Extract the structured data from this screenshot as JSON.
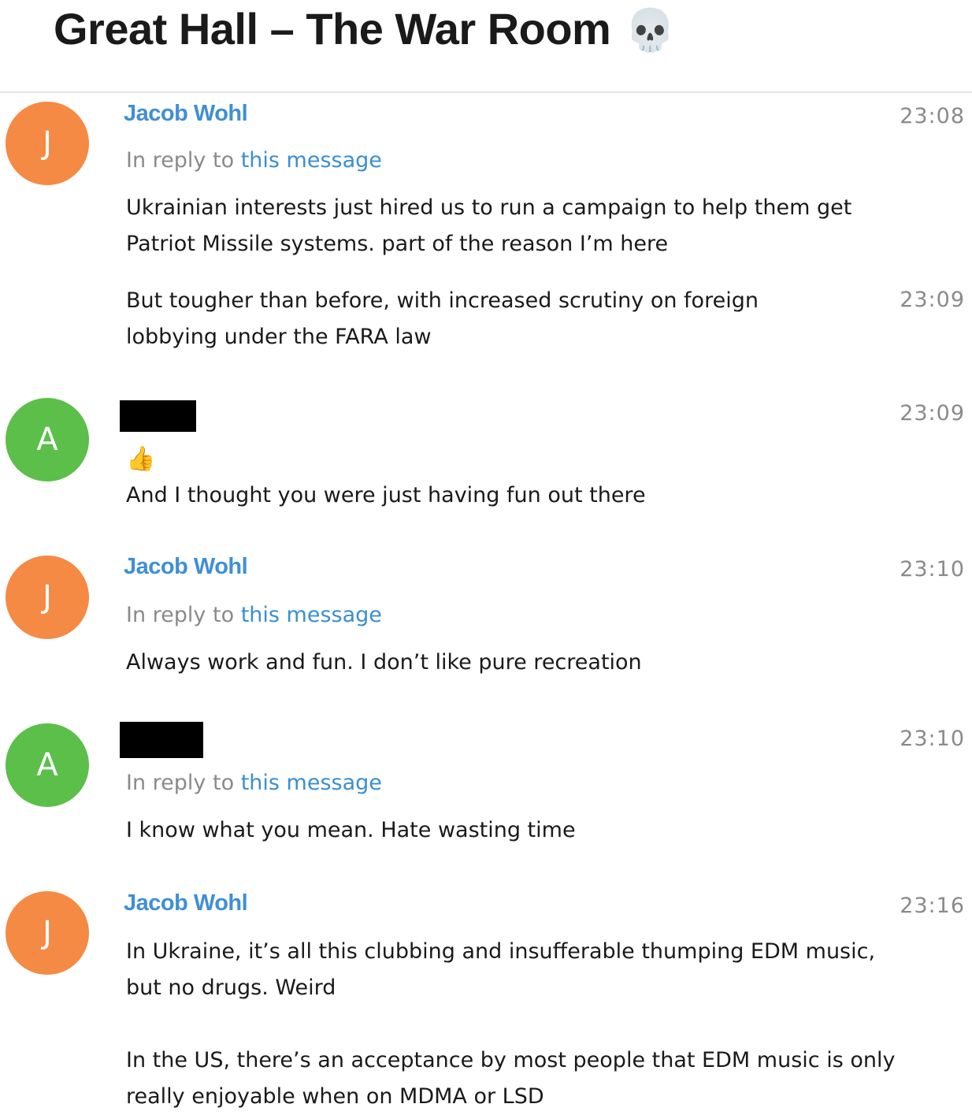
{
  "header": {
    "title": "Great Hall – The War Room",
    "emoji": "💀"
  },
  "messages": [
    {
      "avatar_letter": "J",
      "avatar_color": "#f58a45",
      "author": "Jacob Wohl",
      "time": "23:08",
      "reply_prefix": "In reply to",
      "reply_link": "this message",
      "lines": [
        "Ukrainian interests just hired us to run a campaign to help them get",
        "Patriot Missile systems. part of the reason I’m here"
      ]
    },
    {
      "time": "23:09",
      "lines": [
        "But tougher than before, with increased scrutiny on foreign",
        "lobbying under the FARA law"
      ]
    },
    {
      "avatar_letter": "A",
      "avatar_color": "#5bbf4a",
      "author_redacted": true,
      "time": "23:09",
      "reaction": "👍",
      "lines": [
        "And I thought you were just having fun out there"
      ]
    },
    {
      "avatar_letter": "J",
      "avatar_color": "#f58a45",
      "author": "Jacob Wohl",
      "time": "23:10",
      "reply_prefix": "In reply to",
      "reply_link": "this message",
      "lines": [
        "Always work and fun. I don’t like pure recreation"
      ]
    },
    {
      "avatar_letter": "A",
      "avatar_color": "#5bbf4a",
      "author_redacted": true,
      "time": "23:10",
      "reply_prefix": "In reply to",
      "reply_link": "this message",
      "lines": [
        "I know what you mean. Hate wasting time"
      ]
    },
    {
      "avatar_letter": "J",
      "avatar_color": "#f58a45",
      "author": "Jacob Wohl",
      "time": "23:16",
      "lines": [
        "In Ukraine, it’s all this clubbing and insufferable thumping EDM music,",
        "but no drugs. Weird",
        "",
        "In the US, there’s an acceptance by most people that EDM music is only",
        "really enjoyable when on MDMA or LSD"
      ]
    }
  ]
}
